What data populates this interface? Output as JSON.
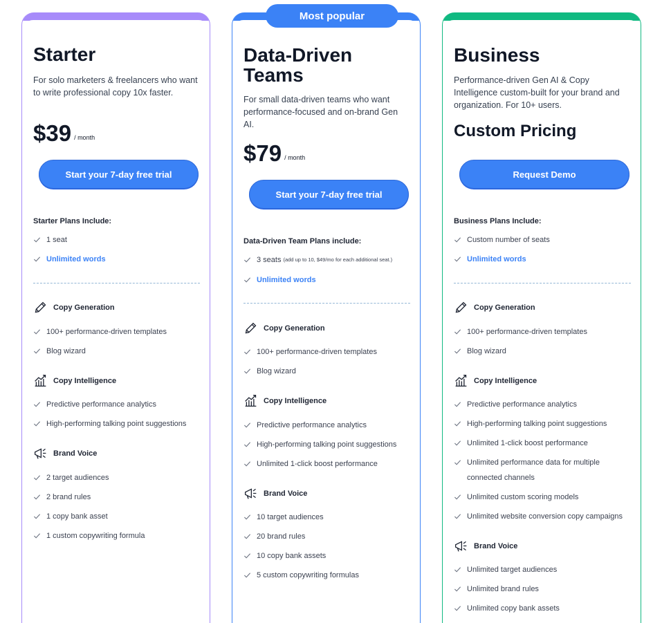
{
  "badge": "Most popular",
  "plans": [
    {
      "title": "Starter",
      "description": "For solo marketers & freelancers who want to write professional copy 10x faster.",
      "price": "$39",
      "period": "/ month",
      "button": "Start your 7-day free trial",
      "includes_heading": "Starter Plans Include:",
      "includes": [
        {
          "text": "1 seat"
        },
        {
          "text": "Unlimited words",
          "link": true
        }
      ],
      "sections": [
        {
          "name": "Copy Generation",
          "icon": "pencil-icon",
          "items": [
            "100+ performance-driven templates",
            "Blog wizard"
          ]
        },
        {
          "name": "Copy Intelligence",
          "icon": "chart-icon",
          "items": [
            "Predictive performance analytics",
            "High-performing talking point suggestions"
          ]
        },
        {
          "name": "Brand Voice",
          "icon": "megaphone-icon",
          "items": [
            "2 target audiences",
            "2 brand rules",
            "1 copy bank asset",
            "1 custom copywriting formula"
          ]
        }
      ]
    },
    {
      "title_line1": "Data-Driven",
      "title_line2": "Teams",
      "description": "For small data-driven teams who want performance-focused and on-brand Gen AI.",
      "price": "$79",
      "period": "/ month",
      "button": "Start your 7-day free trial",
      "includes_heading": "Data-Driven Team Plans include:",
      "includes": [
        {
          "text": "3 seats",
          "note": "(add up to 10, $49/mo for each additional seat.)"
        },
        {
          "text": "Unlimited words",
          "link": true
        }
      ],
      "sections": [
        {
          "name": "Copy Generation",
          "icon": "pencil-icon",
          "items": [
            "100+ performance-driven templates",
            "Blog wizard"
          ]
        },
        {
          "name": "Copy Intelligence",
          "icon": "chart-icon",
          "items": [
            "Predictive performance analytics",
            "High-performing talking point suggestions",
            "Unlimited 1-click boost performance"
          ]
        },
        {
          "name": "Brand Voice",
          "icon": "megaphone-icon",
          "items": [
            "10 target audiences",
            "20 brand rules",
            "10 copy bank assets",
            "5 custom copywriting formulas"
          ]
        }
      ]
    },
    {
      "title": "Business",
      "description": "Performance-driven Gen AI & Copy Intelligence custom-built for your brand and organization. For 10+ users.",
      "price_label": "Custom Pricing",
      "button": "Request Demo",
      "includes_heading": "Business Plans Include:",
      "includes": [
        {
          "text": "Custom number of seats"
        },
        {
          "text": "Unlimited words",
          "link": true
        }
      ],
      "sections": [
        {
          "name": "Copy Generation",
          "icon": "pencil-icon",
          "items": [
            "100+ performance-driven templates",
            "Blog wizard"
          ]
        },
        {
          "name": "Copy Intelligence",
          "icon": "chart-icon",
          "items": [
            "Predictive performance analytics",
            "High-performing talking point suggestions",
            "Unlimited 1-click boost performance",
            "Unlimited performance data for multiple connected channels",
            "Unlimited custom scoring models",
            "Unlimited website conversion copy campaigns"
          ]
        },
        {
          "name": "Brand Voice",
          "icon": "megaphone-icon",
          "items": [
            "Unlimited target audiences",
            "Unlimited brand rules",
            "Unlimited copy bank assets"
          ]
        }
      ]
    }
  ]
}
